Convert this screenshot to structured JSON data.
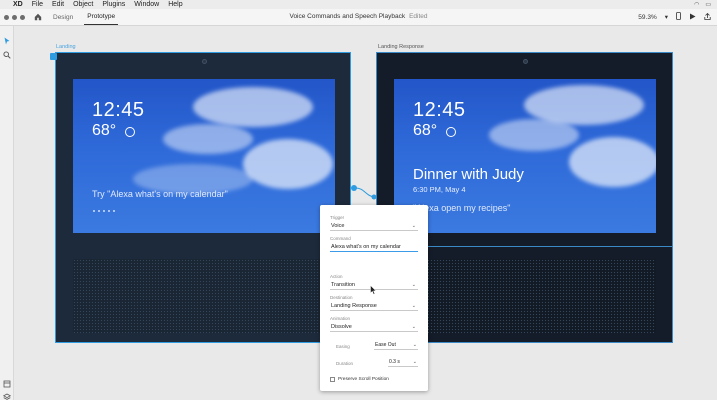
{
  "menubar": {
    "app": "XD",
    "items": [
      "File",
      "Edit",
      "Object",
      "Plugins",
      "Window",
      "Help"
    ]
  },
  "toolbar": {
    "tabs": [
      {
        "label": "Design",
        "active": false
      },
      {
        "label": "Prototype",
        "active": true
      }
    ],
    "title": "Voice Commands and Speech Playback",
    "status": "Edited",
    "zoom": "59.3%"
  },
  "artboards": [
    {
      "name": "Landing",
      "time": "12:45",
      "temp": "68°",
      "prompt": "Try \"Alexa what's on my calendar\""
    },
    {
      "name": "Landing Response",
      "time": "12:45",
      "temp": "68°",
      "headline": "Dinner with Judy",
      "subline": "6:30 PM, May 4",
      "prompt": "\"Alexa open my recipes\""
    }
  ],
  "panel": {
    "trigger_label": "Trigger",
    "trigger_value": "Voice",
    "command_label": "Command",
    "command_value": "Alexa what's on my calendar",
    "action_label": "Action",
    "action_value": "Transition",
    "destination_label": "Destination",
    "destination_value": "Landing Response",
    "animation_label": "Animation",
    "animation_value": "Dissolve",
    "easing_label": "Easing",
    "easing_value": "Ease Out",
    "duration_label": "Duration",
    "duration_value": "0.3 s",
    "preserve_label": "Preserve Scroll Position"
  },
  "colors": {
    "accent": "#2f9be0",
    "screen_blue": "#2f6ad9",
    "device_dark": "#1c2a3c"
  },
  "icons": [
    "apple-icon",
    "home-icon",
    "select-tool-icon",
    "zoom-tool-icon",
    "play-icon",
    "mobile-preview-icon",
    "share-icon",
    "layers-icon",
    "assets-icon",
    "chevron-down-icon",
    "sun-icon"
  ]
}
